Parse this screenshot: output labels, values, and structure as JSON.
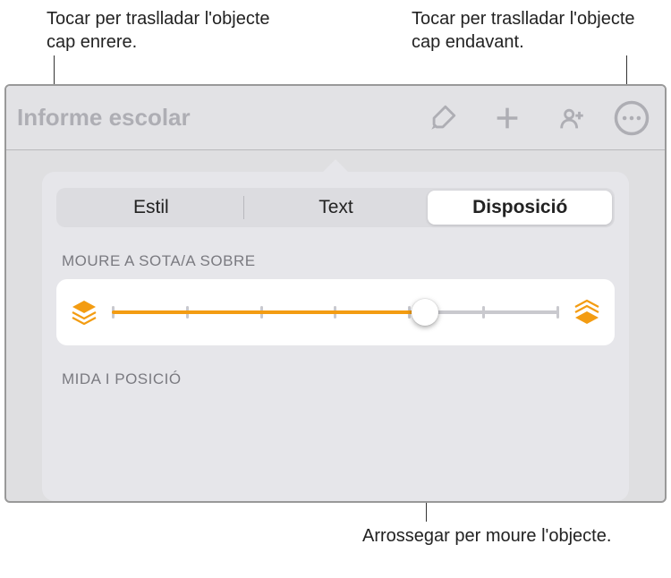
{
  "callouts": {
    "top_left": "Tocar per traslladar l'objecte cap enrere.",
    "top_right": "Tocar per traslladar l'objecte cap endavant.",
    "bottom": "Arrossegar per moure l'objecte."
  },
  "toolbar": {
    "doc_title": "Informe escolar",
    "icons": {
      "format": "paintbrush-icon",
      "add": "plus-icon",
      "collab": "person-add-icon",
      "more": "ellipsis-circle-icon"
    }
  },
  "popover": {
    "segmented": {
      "items": [
        "Estil",
        "Text",
        "Disposició"
      ],
      "active_index": 2
    },
    "sections": {
      "move_label": "MOURE A SOTA/A SOBRE",
      "size_pos_label": "MIDA I POSICIÓ"
    },
    "slider": {
      "back_icon": "layers-back-icon",
      "front_icon": "layers-front-icon",
      "fill_percent": 70,
      "tick_count": 7,
      "accent_color": "#f39c12"
    }
  }
}
